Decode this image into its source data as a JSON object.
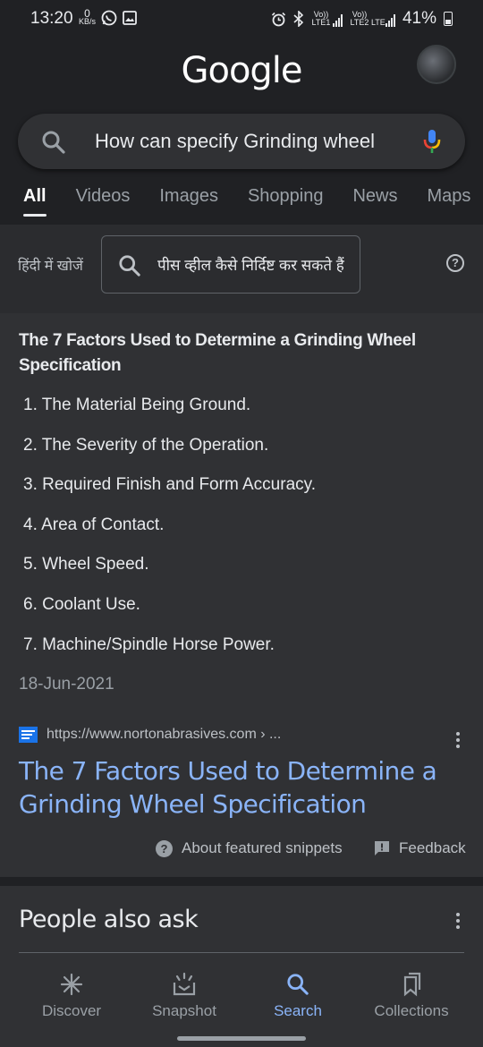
{
  "status_bar": {
    "time": "13:20",
    "data_speed_value": "0",
    "data_speed_unit": "KB/s",
    "sim1_label": "Vo)) LTE1",
    "sim2_label": "Vo)) LTE2",
    "lte_label": "LTE",
    "battery": "41%"
  },
  "header": {
    "logo": "Google"
  },
  "search": {
    "query": "How can specify Grinding wheel"
  },
  "tabs": [
    {
      "label": "All",
      "active": true
    },
    {
      "label": "Videos"
    },
    {
      "label": "Images"
    },
    {
      "label": "Shopping"
    },
    {
      "label": "News"
    },
    {
      "label": "Maps"
    }
  ],
  "hindi": {
    "label": "हिंदी में खोजें",
    "query": "पीस व्हील कैसे निर्दिष्ट कर सकते हैं"
  },
  "snippet": {
    "title": "The 7 Factors Used to Determine a Grinding Wheel Specification",
    "items": [
      "1. The Material Being Ground.",
      "2. The Severity of the Operation.",
      "3. Required Finish and Form Accuracy.",
      "4. Area of Contact.",
      "5. Wheel Speed.",
      "6. Coolant Use.",
      "7. Machine/Spindle Horse Power."
    ],
    "date": "18-Jun-2021",
    "source_url": "https://www.nortonabrasives.com › ...",
    "link_title": "The 7 Factors Used to Determine a Grinding Wheel Specification",
    "about_label": "About featured snippets",
    "feedback_label": "Feedback"
  },
  "people_also_ask": {
    "title": "People also ask"
  },
  "bottom_nav": [
    {
      "label": "Discover",
      "icon": "asterisk-icon"
    },
    {
      "label": "Snapshot",
      "icon": "snapshot-icon"
    },
    {
      "label": "Search",
      "icon": "search-icon",
      "active": true
    },
    {
      "label": "Collections",
      "icon": "bookmarks-icon"
    }
  ],
  "colors": {
    "background": "#202124",
    "card": "#303134",
    "link": "#8ab4f8",
    "text": "#e8eaed"
  }
}
